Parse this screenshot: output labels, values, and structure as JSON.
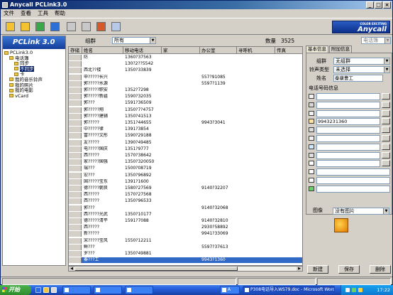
{
  "window": {
    "title": "Anycall PCLink3.0",
    "controls": [
      "_",
      "□",
      "×"
    ]
  },
  "menu": [
    {
      "label": "文件",
      "name": "menu-file"
    },
    {
      "label": "查看",
      "name": "menu-view"
    },
    {
      "label": "工具",
      "name": "menu-tools"
    },
    {
      "label": "帮助",
      "name": "menu-help"
    }
  ],
  "toolbar": {
    "buttons": [
      {
        "name": "toolbar-phone-read-button",
        "color": "#f2c230"
      },
      {
        "name": "toolbar-save-button",
        "color": "#f2c230"
      },
      {
        "name": "toolbar-sync-button",
        "color": "#3aa84a"
      },
      {
        "name": "toolbar-transfer-button",
        "color": "#2e6fd6"
      },
      {
        "name": "toolbar-copy-button",
        "color": "#c8c8c8"
      },
      {
        "name": "toolbar-move-button",
        "color": "#c8c8c8"
      },
      {
        "name": "toolbar-export-button",
        "color": "#d45a2a"
      },
      {
        "name": "toolbar-network-button",
        "color": "#b8c8e8"
      }
    ],
    "brand": {
      "top": "COLOR EXCITING",
      "main": "Anycall"
    }
  },
  "sidebar": {
    "logo": "PCLink 3.0",
    "tree": [
      {
        "label": "PCLink3.0",
        "indent": 0,
        "selected": false,
        "icon": "pc-icon"
      },
      {
        "label": "电话簿",
        "indent": 1,
        "selected": false,
        "icon": "phonebook-icon"
      },
      {
        "label": "同步",
        "indent": 2,
        "selected": false,
        "icon": "sync-icon"
      },
      {
        "label": "不同步",
        "indent": 2,
        "selected": true,
        "icon": "nosync-icon"
      },
      {
        "label": "卡",
        "indent": 2,
        "selected": false,
        "icon": "card-icon"
      },
      {
        "label": "我的音乐铃声",
        "indent": 1,
        "selected": false,
        "icon": "music-icon"
      },
      {
        "label": "我的照片",
        "indent": 1,
        "selected": false,
        "icon": "photo-icon"
      },
      {
        "label": "我的电影",
        "indent": 1,
        "selected": false,
        "icon": "movie-icon"
      },
      {
        "label": "vCard",
        "indent": 1,
        "selected": false,
        "icon": "vcard-icon"
      }
    ]
  },
  "filter": {
    "group_label": "组群",
    "group_value": "所有",
    "count_label": "数量",
    "count_value": "3525"
  },
  "grid": {
    "columns": [
      "存储",
      "姓名",
      "移动电话",
      "家",
      "办公室",
      "寻呼机",
      "传真"
    ],
    "rows": [
      {
        "name": "防",
        "mobile": "1360?37563",
        "office": ""
      },
      {
        "name": "",
        "mobile": "130?2??5542",
        "office": ""
      },
      {
        "name": "西北??楼",
        "mobile": "1350?33839",
        "office": ""
      },
      {
        "name": "申?????长兴",
        "mobile": "",
        "office": "557?91085"
      },
      {
        "name": "郭?????水源",
        "mobile": "",
        "office": "5597?1139"
      },
      {
        "name": "郭?????职安",
        "mobile": "1352?7298",
        "office": ""
      },
      {
        "name": "郭?????新疆",
        "mobile": "1590?32035",
        "office": ""
      },
      {
        "name": "郭???",
        "mobile": "1591?36509",
        "office": ""
      },
      {
        "name": "郭?????翔",
        "mobile": "1350?7?4757",
        "office": ""
      },
      {
        "name": "郭?????建辅",
        "mobile": "1350?41513",
        "office": ""
      },
      {
        "name": "郭?????",
        "mobile": "1351?44655",
        "office": "9943?3041"
      },
      {
        "name": "中?????律",
        "mobile": "1391?3854",
        "office": ""
      },
      {
        "name": "富?????文彤",
        "mobile": "1590?29188",
        "office": ""
      },
      {
        "name": "友?????",
        "mobile": "1390?49485",
        "office": ""
      },
      {
        "name": "电?????国庆",
        "mobile": "1351?9777",
        "office": ""
      },
      {
        "name": "西?????",
        "mobile": "1570?38642",
        "office": ""
      },
      {
        "name": "家?????国强",
        "mobile": "1350?320050",
        "office": ""
      },
      {
        "name": "瑞???",
        "mobile": "1500?08719",
        "office": ""
      },
      {
        "name": "宏???",
        "mobile": "1350?96892",
        "office": ""
      },
      {
        "name": "国?????宝东",
        "mobile": "1391?1600",
        "office": ""
      },
      {
        "name": "德?????朝良",
        "mobile": "1580?27569",
        "office": "9140?32207"
      },
      {
        "name": "西?????",
        "mobile": "1570?27568",
        "office": ""
      },
      {
        "name": "西?????",
        "mobile": "1350?96533",
        "office": ""
      },
      {
        "name": "郭???",
        "mobile": "",
        "office": "9140?32068"
      },
      {
        "name": "西?????光武",
        "mobile": "1350?10177",
        "office": ""
      },
      {
        "name": "德?????清平",
        "mobile": "1591?7088",
        "office": "9140?32810"
      },
      {
        "name": "西?????",
        "mobile": "",
        "office": "2930?58892"
      },
      {
        "name": "新?????",
        "mobile": "",
        "office": "9941?33069"
      },
      {
        "name": "宋?????宝风",
        "mobile": "1550?12211",
        "office": ""
      },
      {
        "name": "鲜???",
        "mobile": "",
        "office": "5597?37613"
      },
      {
        "name": "罗???",
        "mobile": "1350?49881",
        "office": ""
      },
      {
        "name": "秦???工",
        "mobile": "",
        "office": "9943?1360"
      }
    ],
    "selected_row": 31
  },
  "right_panel": {
    "top_combo": "电话簿",
    "tabs": [
      "基本信息",
      "附加信息"
    ],
    "group_label": "组群",
    "group_value": "无组群",
    "ring_label": "铃声类型",
    "ring_value": "未选择",
    "name_label": "姓名",
    "name_value": "秦康曹工",
    "section_title": "电话号码信息",
    "phone_fields": [
      "",
      "",
      "",
      "9943231360",
      "",
      "",
      "",
      "",
      "",
      "",
      "",
      ""
    ],
    "image_label": "图像",
    "image_value": "没有图片",
    "buttons": {
      "new": "新建",
      "save": "保存",
      "delete": "删除"
    }
  },
  "status": {
    "cells": [
      "",
      "",
      ""
    ]
  },
  "taskbar": {
    "start": "开始",
    "items": [
      {
        "label": "",
        "active": false
      },
      {
        "label": "",
        "active": false
      },
      {
        "label": "",
        "active": false
      },
      {
        "label": "A",
        "active": false
      },
      {
        "label": "P308电话导入WS79.doc - Microsoft Word",
        "active": true
      }
    ],
    "clock": "17:22"
  }
}
